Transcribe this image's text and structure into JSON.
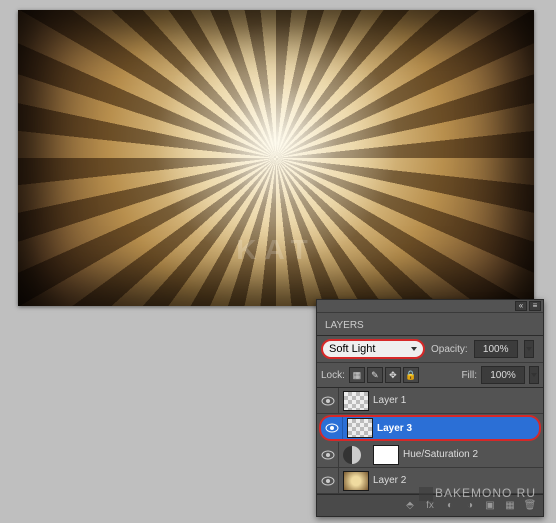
{
  "watermark": "KAT",
  "site_watermark": "BAKEMONO RU",
  "panel": {
    "title": "LAYERS",
    "collapse": "«",
    "menu": "≡",
    "blend_mode": "Soft Light",
    "opacity_label": "Opacity:",
    "opacity_value": "100%",
    "lock_label": "Lock:",
    "fill_label": "Fill:",
    "fill_value": "100%"
  },
  "layers": [
    {
      "name": "Layer 1"
    },
    {
      "name": "Layer 3"
    },
    {
      "name": "Hue/Saturation 2"
    },
    {
      "name": "Layer 2"
    }
  ]
}
